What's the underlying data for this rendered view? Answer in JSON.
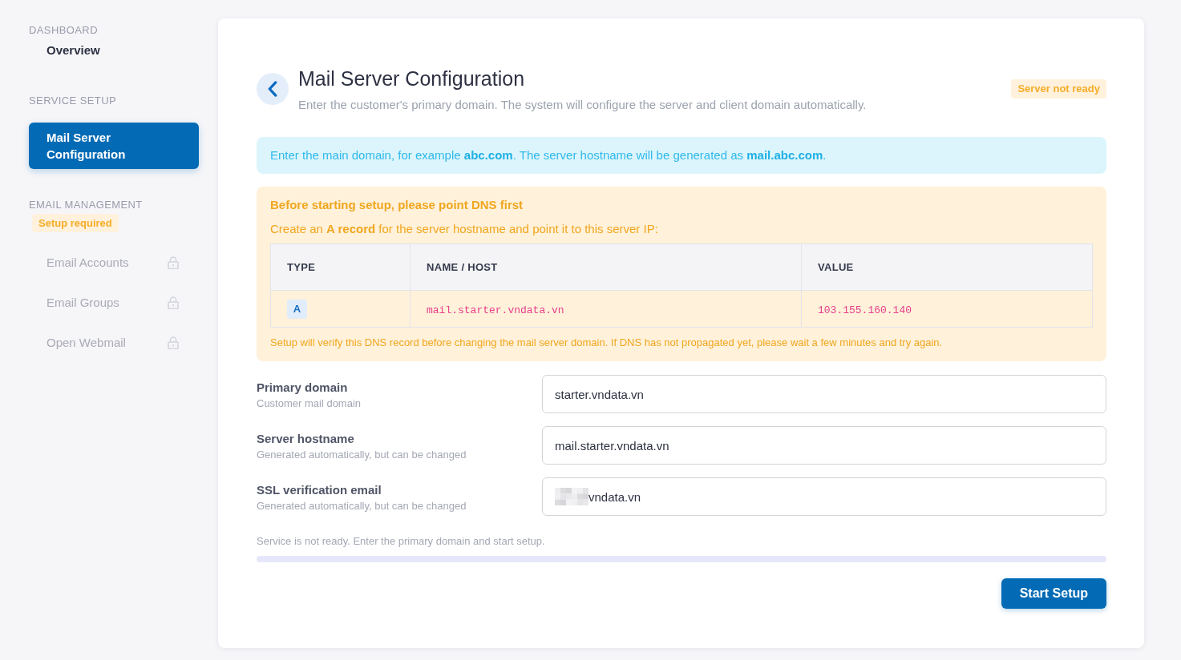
{
  "sidebar": {
    "sections": [
      {
        "heading": "DASHBOARD",
        "items": [
          {
            "label": "Overview",
            "selected": false,
            "disabled": false
          }
        ]
      },
      {
        "heading": "SERVICE SETUP",
        "items": [
          {
            "label": "Mail Server Configuration",
            "selected": true,
            "disabled": false
          }
        ]
      },
      {
        "heading": "EMAIL MANAGEMENT",
        "badge": "Setup required",
        "items": [
          {
            "label": "Email Accounts",
            "selected": false,
            "disabled": true
          },
          {
            "label": "Email Groups",
            "selected": false,
            "disabled": true
          },
          {
            "label": "Open Webmail",
            "selected": false,
            "disabled": true
          }
        ]
      }
    ]
  },
  "page": {
    "title": "Mail Server Configuration",
    "subtitle": "Enter the customer's primary domain. The system will configure the server and client domain automatically.",
    "status_badge": "Server not ready"
  },
  "info_alert": {
    "text": "Enter the main domain, for example **abc.com**. The server hostname will be generated as **mail.abc.com**."
  },
  "dns_alert": {
    "title": "Before starting setup, please point DNS first",
    "instruction": "Create an **A record** for the server hostname and point it to this server IP:",
    "table": {
      "columns": [
        "TYPE",
        "NAME / HOST",
        "VALUE"
      ],
      "rows": [
        {
          "type": "A",
          "name": "mail.starter.vndata.vn",
          "value": "103.155.160.140"
        }
      ]
    },
    "note": "Setup will verify this DNS record before changing the mail server domain. If DNS has not propagated yet, please wait a few minutes and try again."
  },
  "form": {
    "fields": [
      {
        "label": "Primary domain",
        "hint": "Customer mail domain",
        "value": "starter.vndata.vn",
        "redacted": false
      },
      {
        "label": "Server hostname",
        "hint": "Generated automatically, but can be changed",
        "value": "mail.starter.vndata.vn",
        "redacted": false
      },
      {
        "label": "SSL verification email",
        "hint": "Generated automatically, but can be changed",
        "value": "vndata.vn",
        "redacted": true
      }
    ]
  },
  "status": {
    "message": "Service is not ready. Enter the primary domain and start setup.",
    "level": 0
  },
  "buttons": [
    "Start Setup"
  ]
}
